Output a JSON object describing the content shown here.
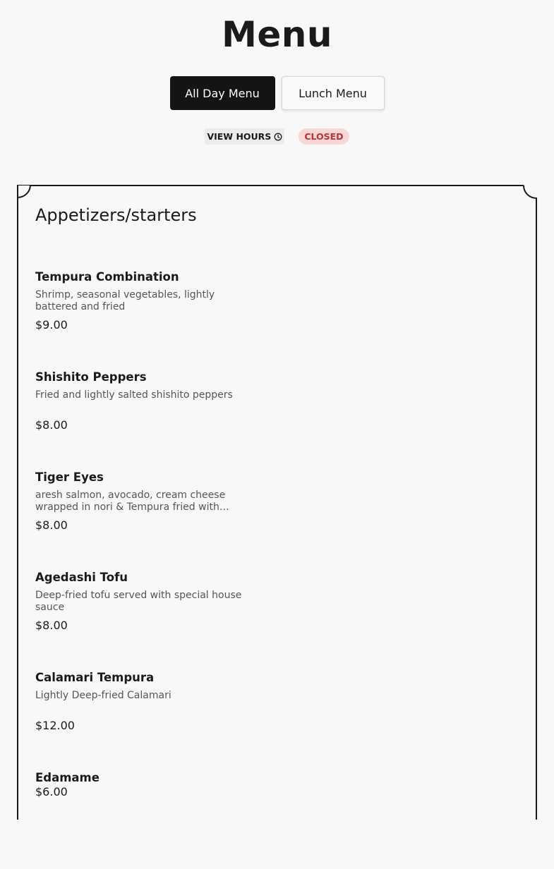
{
  "page": {
    "title": "Menu"
  },
  "tabs": [
    {
      "label": "All Day Menu",
      "active": true
    },
    {
      "label": "Lunch Menu",
      "active": false
    }
  ],
  "hours": {
    "view_hours_label": "VIEW HOURS",
    "icon": "clock-icon",
    "status": "CLOSED"
  },
  "section": {
    "title": "Appetizers/starters",
    "items": [
      {
        "name": "Tempura Combination",
        "description": "Shrimp, seasonal vegetables, lightly battered and fried",
        "price": "$9.00"
      },
      {
        "name": "Shishito Peppers",
        "description": "Fried and lightly salted shishito peppers",
        "price": "$8.00"
      },
      {
        "name": "Tiger Eyes",
        "description": "aresh salmon, avocado, cream cheese wrapped in nori & Tempura fried with…",
        "price": "$8.00"
      },
      {
        "name": "Agedashi Tofu",
        "description": "Deep-fried tofu served with special house sauce",
        "price": "$8.00"
      },
      {
        "name": "Calamari Tempura",
        "description": "Lightly Deep-fried Calamari",
        "price": "$12.00"
      },
      {
        "name": "Edamame",
        "description": "",
        "price": "$6.00"
      }
    ]
  },
  "colors": {
    "background": "#f8f8f8",
    "active_tab": "#141414",
    "closed_badge_bg": "#f8d7d7",
    "closed_badge_text": "#b83434"
  }
}
